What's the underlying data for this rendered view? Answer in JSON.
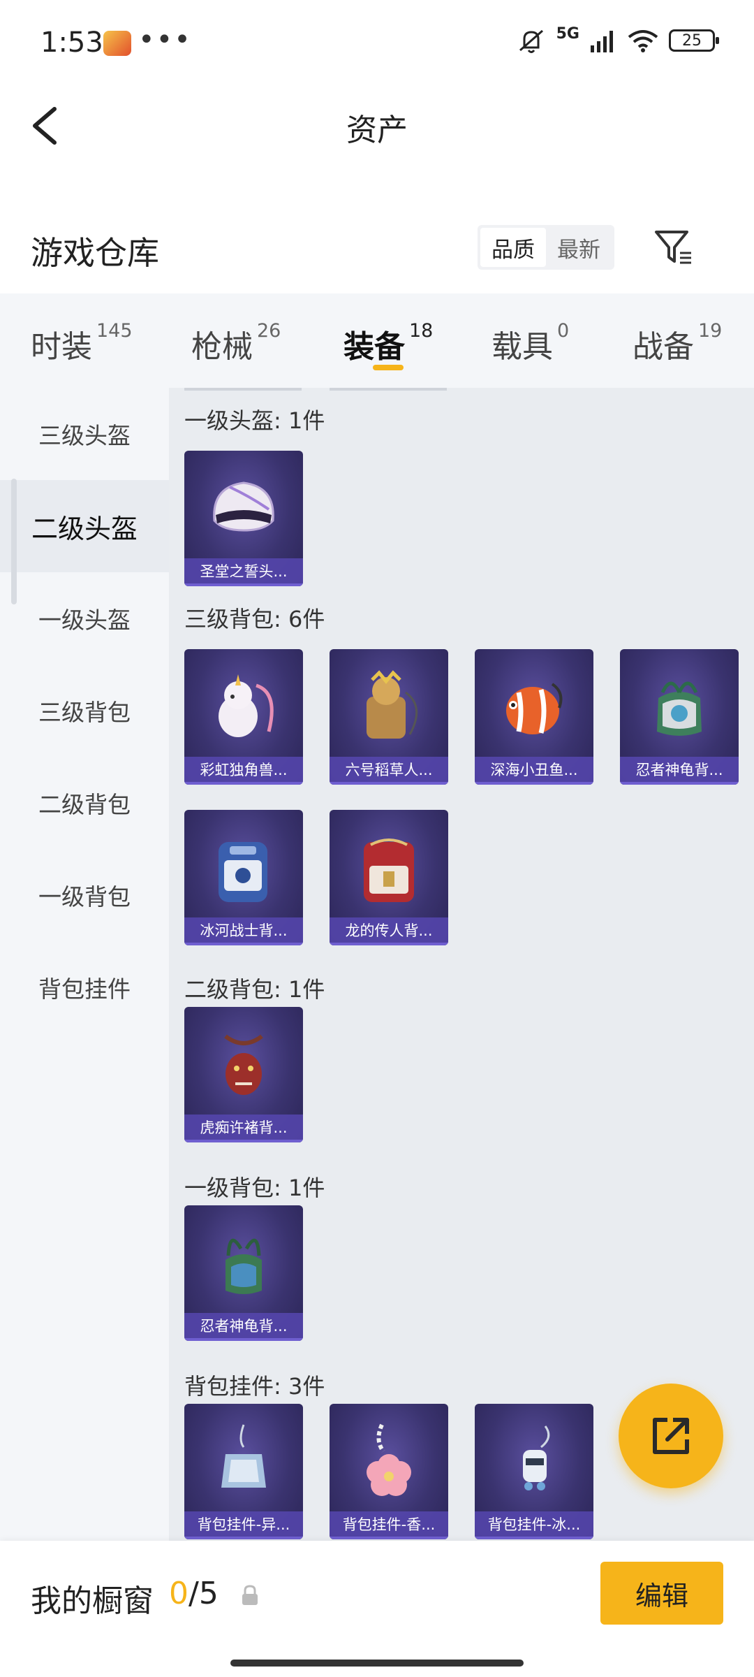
{
  "status_bar": {
    "time": "1:53",
    "dots": "•••",
    "network": "5G",
    "battery": "25"
  },
  "header": {
    "title": "资产",
    "back_icon": "chevron-left-icon"
  },
  "warehouse": {
    "title": "游戏仓库",
    "sort_options": [
      "品质",
      "最新"
    ],
    "sort_selected": "品质",
    "filter_icon": "filter-icon"
  },
  "tabs": [
    {
      "label": "时装",
      "count": "145"
    },
    {
      "label": "枪械",
      "count": "26"
    },
    {
      "label": "装备",
      "count": "18"
    },
    {
      "label": "载具",
      "count": "0"
    },
    {
      "label": "战备",
      "count": "19"
    }
  ],
  "active_tab": "装备",
  "sidenav": {
    "items": [
      "三级头盔",
      "二级头盔",
      "一级头盔",
      "三级背包",
      "二级背包",
      "一级背包",
      "背包挂件"
    ],
    "active": "二级头盔"
  },
  "sections": [
    {
      "title": "一级头盔: 1件",
      "items": [
        "圣堂之誓头..."
      ]
    },
    {
      "title": "三级背包: 6件",
      "items": [
        "彩虹独角兽...",
        "六号稻草人...",
        "深海小丑鱼...",
        "忍者神龟背...",
        "冰河战士背...",
        "龙的传人背..."
      ]
    },
    {
      "title": "二级背包: 1件",
      "items": [
        "虎痴许褚背..."
      ]
    },
    {
      "title": "一级背包: 1件",
      "items": [
        "忍者神龟背..."
      ]
    },
    {
      "title": "背包挂件: 3件",
      "items": [
        "背包挂件-异...",
        "背包挂件-香...",
        "背包挂件-冰..."
      ]
    }
  ],
  "fab_icon": "share-external-icon",
  "showcase": {
    "label": "我的橱窗",
    "current": "0",
    "total": "/5",
    "lock_icon": "lock-icon",
    "edit_label": "编辑"
  },
  "colors": {
    "accent": "#f6b41a",
    "card_bg": "#3a336f",
    "card_label": "#5646af"
  }
}
